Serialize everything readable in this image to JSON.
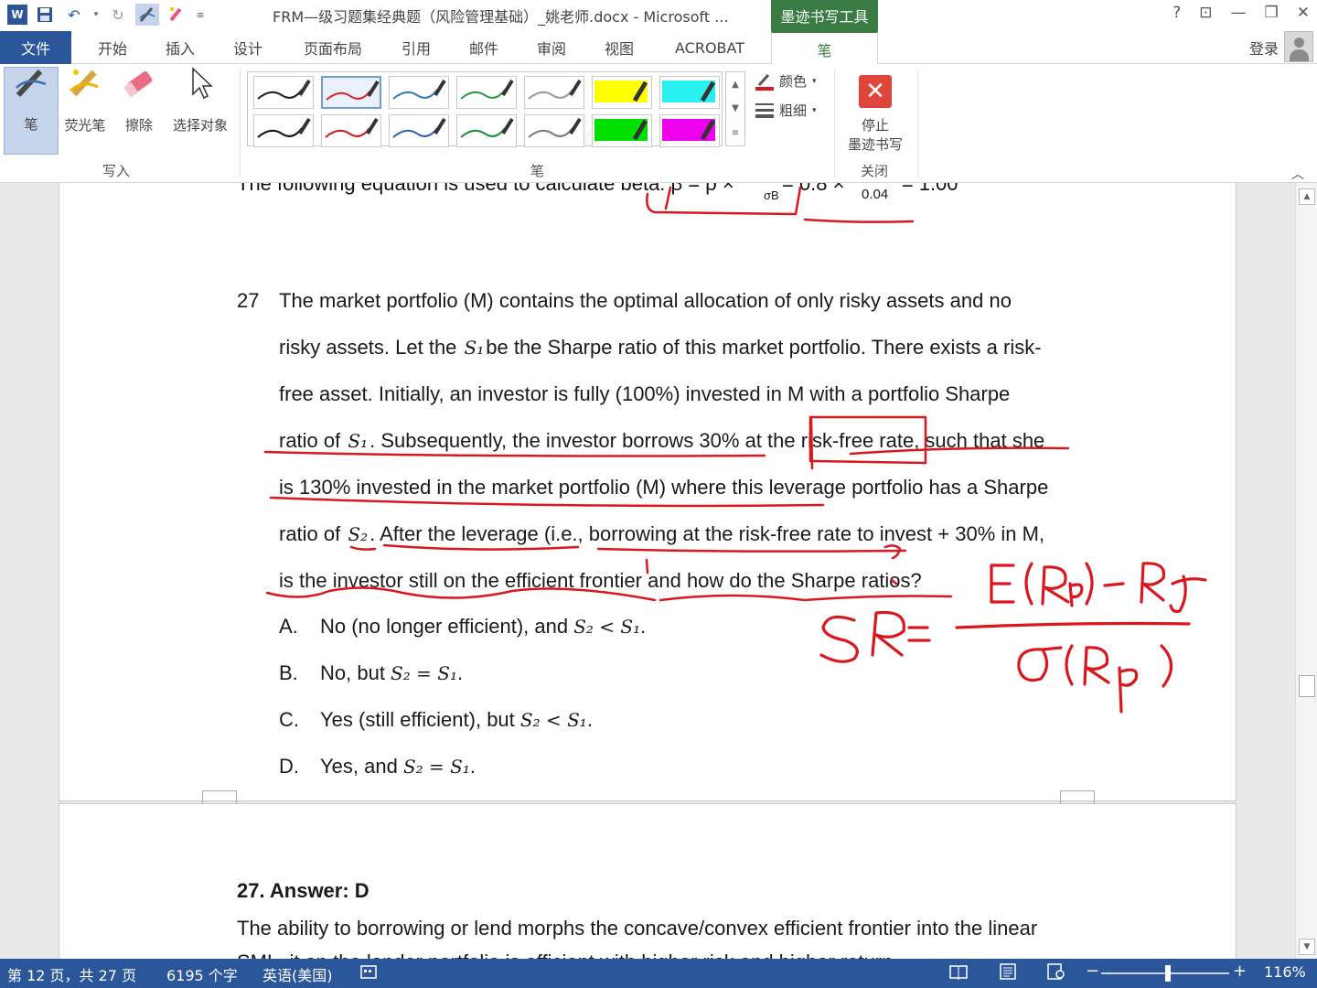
{
  "titlebar": {
    "document_title": "FRM—级习题集经典题（风险管理基础）_姚老师.docx - Microsoft ...",
    "context_tab": "墨迹书写工具",
    "help": "?",
    "restore_ribbon": "⊡",
    "minimize": "—",
    "maximize": "❐",
    "close": "✕"
  },
  "tabs": {
    "file": "文件",
    "home": "开始",
    "insert": "插入",
    "design": "设计",
    "layout": "页面布局",
    "references": "引用",
    "mailings": "邮件",
    "review": "审阅",
    "view": "视图",
    "acrobat": "ACROBAT",
    "pen": "笔",
    "sign_in": "登录"
  },
  "ribbon": {
    "write_group": {
      "label": "写入",
      "pen": "笔",
      "highlighter": "荧光笔",
      "eraser": "擦除",
      "select": "选择对象"
    },
    "pens_group": {
      "label": "笔",
      "color": "颜色",
      "thickness": "粗细",
      "swatches": [
        {
          "color": "#222222",
          "kind": "pen"
        },
        {
          "color": "#d62c2c",
          "kind": "pen"
        },
        {
          "color": "#3c78b4",
          "kind": "pen"
        },
        {
          "color": "#2e9b4a",
          "kind": "pen"
        },
        {
          "color": "#9a9a9a",
          "kind": "pen"
        },
        {
          "color": "#ffff00",
          "kind": "highlighter"
        },
        {
          "color": "#29f0f0",
          "kind": "highlighter"
        },
        {
          "color": "#111111",
          "kind": "pen"
        },
        {
          "color": "#c81e1e",
          "kind": "pen"
        },
        {
          "color": "#2e64a8",
          "kind": "pen"
        },
        {
          "color": "#1f8a3c",
          "kind": "pen"
        },
        {
          "color": "#7a7a7a",
          "kind": "pen"
        },
        {
          "color": "#00e000",
          "kind": "highlighter"
        },
        {
          "color": "#ee00ee",
          "kind": "highlighter"
        }
      ]
    },
    "close_group": {
      "label": "关闭",
      "stop_line1": "停止",
      "stop_line2": "墨迹书写"
    }
  },
  "document": {
    "cropped_line": "The following equation is used to calculate beta: β = ρ ×",
    "cropped_frac_denom": "σB",
    "cropped_tail": "= 0.8 ×",
    "cropped_frac2": "0.04",
    "cropped_result": "= 1.00",
    "question_number": "27",
    "question_lines": [
      [
        "The market portfolio (M) contains the optimal allocation of only risky assets and no"
      ],
      [
        "risky assets. Let the ",
        "S₁",
        "be the Sharpe ratio of this market portfolio. There exists a risk-"
      ],
      [
        "free asset. Initially, an investor is fully (100%) invested in M with a portfolio Sharpe"
      ],
      [
        "ratio of ",
        "S₁",
        ". Subsequently, the investor borrows 30% at the risk-free rate, such that she"
      ],
      [
        "is 130% invested in the market portfolio (M) where this leverage portfolio has a Sharpe"
      ],
      [
        "ratio of ",
        "S₂",
        ". After the leverage (i.e., borrowing at the risk-free rate to invest + 30% in M,"
      ],
      [
        "is the investor still on the efficient frontier and how do the Sharpe ratios?"
      ]
    ],
    "options": [
      {
        "letter": "A.",
        "text": "No (no longer efficient), and ",
        "math": "S₂ < S₁",
        "end": "."
      },
      {
        "letter": "B.",
        "text": "No, but ",
        "math": "S₂ = S₁",
        "end": "."
      },
      {
        "letter": "C.",
        "text": "Yes (still efficient), but ",
        "math": "S₂ < S₁",
        "end": "."
      },
      {
        "letter": "D.",
        "text": "Yes, and ",
        "math": "S₂ = S₁",
        "end": "."
      }
    ],
    "answer_heading": "27.  Answer: D",
    "answer_text": "The ability to borrowing or lend morphs the concave/convex efficient frontier into the linear",
    "answer_text_cropped": "SML. it on the lender portfolio is efficient with higher risk and higher return."
  },
  "ink": {
    "color": "#d8181e",
    "formula_label": "SR=",
    "numerator": "E(Rp)- Rf",
    "denominator": "σ(Rp)"
  },
  "statusbar": {
    "page": "第 12 页，共 27 页",
    "words": "6195 个字",
    "language": "英语(美国)",
    "zoom": "116%",
    "zoom_level": 1.16
  }
}
